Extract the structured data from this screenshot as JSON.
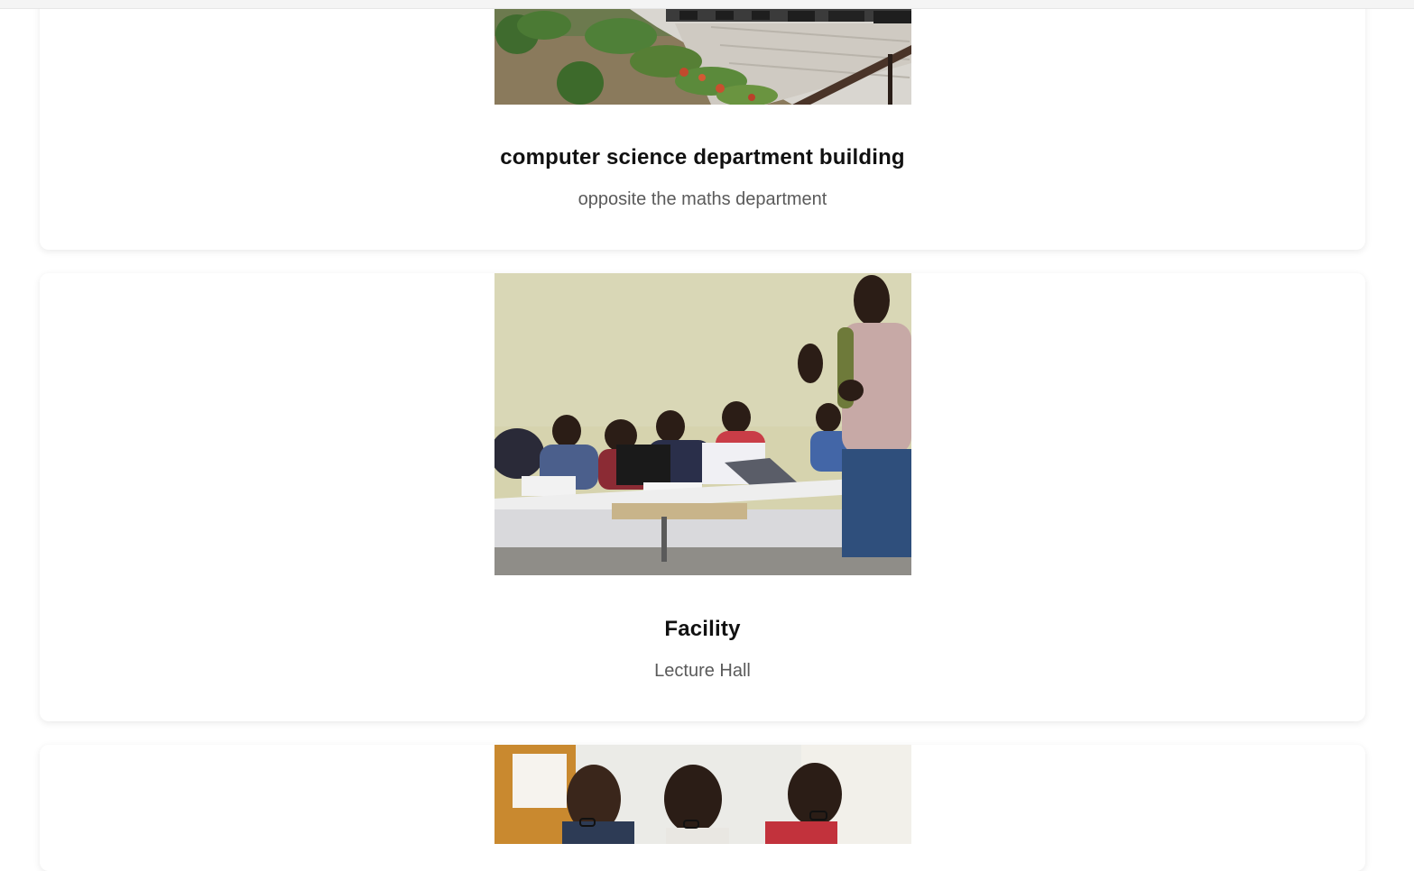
{
  "cards": [
    {
      "title": "computer science department building",
      "subtitle": "opposite the maths department",
      "image": "building-photo"
    },
    {
      "title": "Facility",
      "subtitle": "Lecture Hall",
      "image": "lecture-hall-photo"
    },
    {
      "title": "",
      "subtitle": "",
      "image": "students-photo"
    }
  ]
}
